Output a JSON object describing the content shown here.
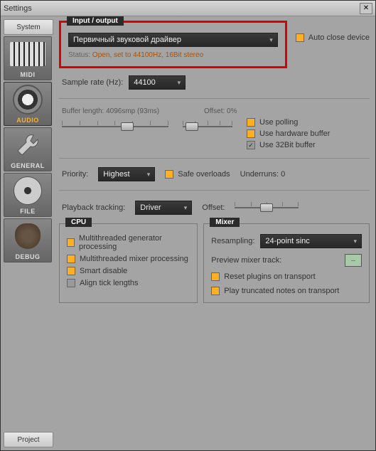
{
  "window": {
    "title": "Settings"
  },
  "sidebar": {
    "top_tab": "System",
    "bottom_tab": "Project",
    "items": [
      {
        "label": "MIDI"
      },
      {
        "label": "AUDIO"
      },
      {
        "label": "GENERAL"
      },
      {
        "label": "FILE"
      },
      {
        "label": "DEBUG"
      }
    ]
  },
  "io": {
    "group_label": "Input / output",
    "driver": "Первичный звуковой драйвер",
    "status_label": "Status:",
    "status_value": "Open, set to 44100Hz, 16Bit stereo",
    "auto_close": "Auto close device"
  },
  "sample_rate": {
    "label": "Sample rate (Hz):",
    "value": "44100"
  },
  "buffer": {
    "length_label": "Buffer length: 4096smp (93ms)",
    "offset_label": "Offset: 0%",
    "use_polling": "Use polling",
    "use_hw_buffer": "Use hardware buffer",
    "use_32bit": "Use 32Bit buffer"
  },
  "priority": {
    "label": "Priority:",
    "value": "Highest",
    "safe_overloads": "Safe overloads",
    "underruns_label": "Underruns: 0"
  },
  "playback": {
    "label": "Playback tracking:",
    "value": "Driver",
    "offset_label": "Offset:"
  },
  "cpu": {
    "group_label": "CPU",
    "mt_gen": "Multithreaded generator processing",
    "mt_mix": "Multithreaded mixer processing",
    "smart_disable": "Smart disable",
    "align_tick": "Align tick lengths"
  },
  "mixer": {
    "group_label": "Mixer",
    "resampling_label": "Resampling:",
    "resampling_value": "24-point sinc",
    "preview_label": "Preview mixer track:",
    "preview_value": "--",
    "reset_plugins": "Reset plugins on transport",
    "play_truncated": "Play truncated notes on transport"
  }
}
